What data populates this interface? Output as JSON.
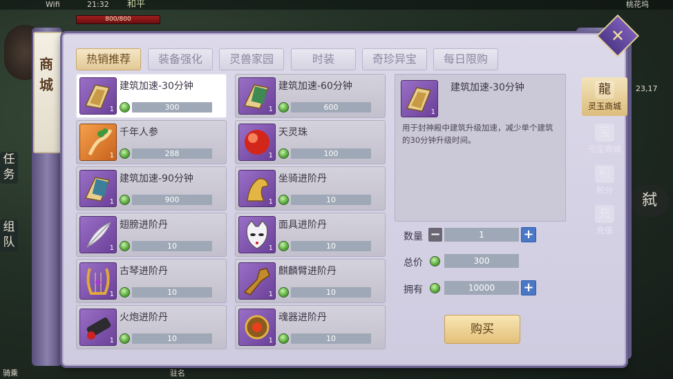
{
  "status": {
    "wifi": "Wifi",
    "time": "21:32",
    "mode": "和平",
    "location": "桃花坞"
  },
  "hud": {
    "hp": "800/800",
    "coord": "23,17",
    "task": "任务",
    "team": "组队",
    "right_button": "弑",
    "bottom_left": "骑乘",
    "bottom_center": "驻名"
  },
  "scroll_title": "商城",
  "tabs": [
    "热销推荐",
    "装备强化",
    "灵兽家园",
    "时装",
    "奇珍异宝",
    "每日限购"
  ],
  "items": [
    {
      "name": "建筑加速-30分钟",
      "qty": "1",
      "price": "300",
      "icon": "token-icon"
    },
    {
      "name": "建筑加速-60分钟",
      "qty": "1",
      "price": "600",
      "icon": "token-icon"
    },
    {
      "name": "千年人参",
      "qty": "1",
      "price": "288",
      "icon": "ginseng-icon"
    },
    {
      "name": "天灵珠",
      "qty": "1",
      "price": "100",
      "icon": "orb-icon"
    },
    {
      "name": "建筑加速-90分钟",
      "qty": "1",
      "price": "900",
      "icon": "token-icon"
    },
    {
      "name": "坐骑进阶丹",
      "qty": "1",
      "price": "10",
      "icon": "horse-icon"
    },
    {
      "name": "翅膀进阶丹",
      "qty": "1",
      "price": "10",
      "icon": "feather-icon"
    },
    {
      "name": "面具进阶丹",
      "qty": "1",
      "price": "10",
      "icon": "mask-icon"
    },
    {
      "name": "古琴进阶丹",
      "qty": "1",
      "price": "10",
      "icon": "harp-icon"
    },
    {
      "name": "麒麟臂进阶丹",
      "qty": "1",
      "price": "10",
      "icon": "arm-icon"
    },
    {
      "name": "火炮进阶丹",
      "qty": "1",
      "price": "10",
      "icon": "cannon-icon"
    },
    {
      "name": "魂器进阶丹",
      "qty": "1",
      "price": "10",
      "icon": "relic-icon"
    }
  ],
  "detail": {
    "name": "建筑加速-30分钟",
    "qty": "1",
    "desc": "用于封神殿中建筑升级加速，减少单个建筑的30分钟升级时间。",
    "quantity_label": "数量",
    "quantity": "1",
    "total_label": "总价",
    "total": "300",
    "own_label": "拥有",
    "own": "10000",
    "buy": "购买"
  },
  "side_menu": [
    {
      "label": "灵玉商城",
      "icon": "jade-dragon-icon",
      "glyph": "龍"
    },
    {
      "label": "元宝商城",
      "icon": "ingot-icon",
      "glyph": "宝"
    },
    {
      "label": "积分",
      "icon": "points-bag-icon",
      "glyph": "积"
    },
    {
      "label": "充值",
      "icon": "recharge-icon",
      "glyph": "充"
    }
  ],
  "colors": {
    "accent_gold": "#e3c07a",
    "panel": "#dcd9ea",
    "price_bar": "#9fa8b6",
    "jade": "#57a83a"
  }
}
